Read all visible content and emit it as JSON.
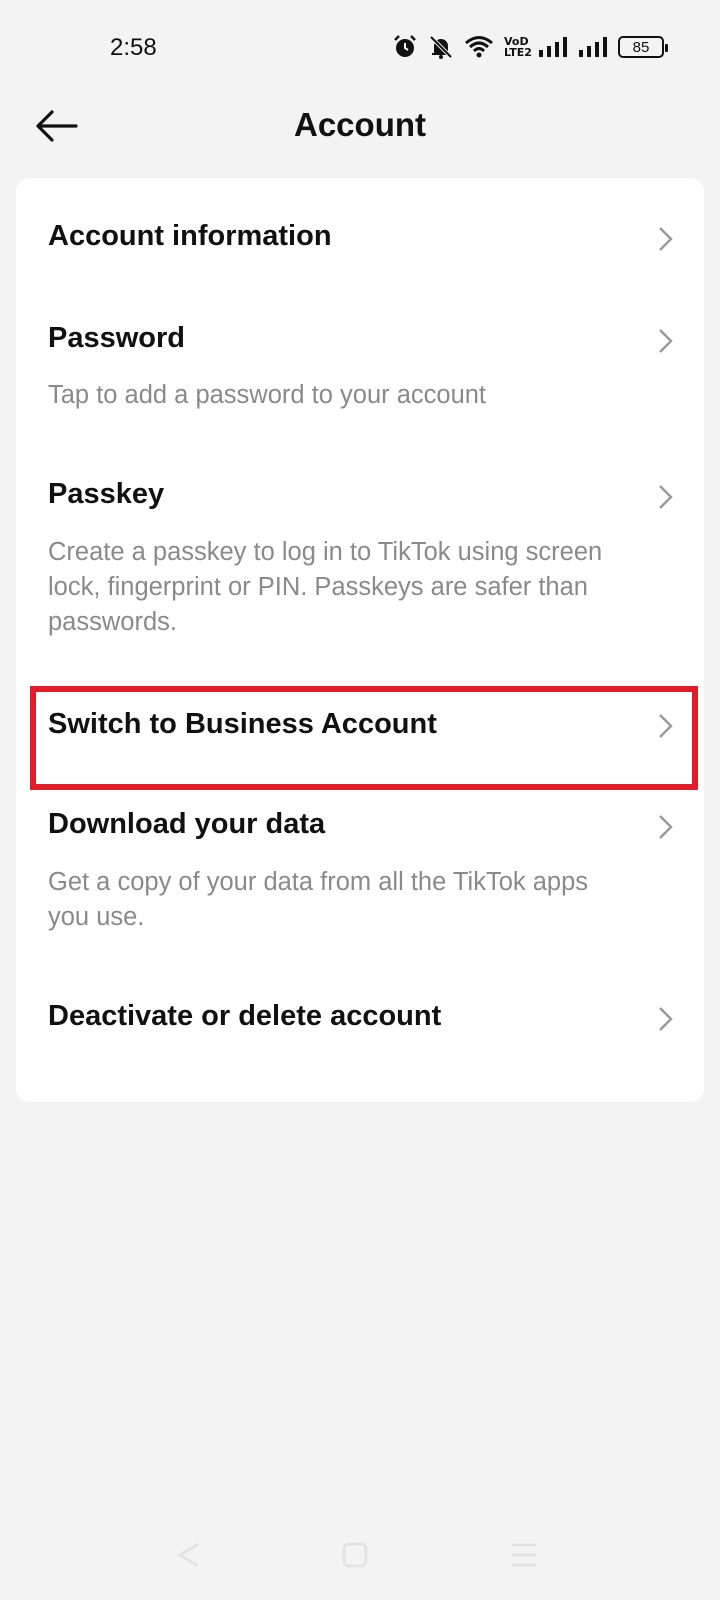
{
  "status_bar": {
    "time": "2:58",
    "network_label": "VoD LTE2",
    "battery": "85"
  },
  "header": {
    "title": "Account"
  },
  "items": [
    {
      "title": "Account information",
      "description": ""
    },
    {
      "title": "Password",
      "description": "Tap to add a password to your account"
    },
    {
      "title": "Passkey",
      "description": "Create a passkey to log in to TikTok using screen lock, fingerprint or PIN. Passkeys are safer than passwords."
    },
    {
      "title": "Switch to Business Account",
      "description": "",
      "highlighted": true
    },
    {
      "title": "Download your data",
      "description": "Get a copy of your data from all the TikTok apps you use."
    },
    {
      "title": "Deactivate or delete account",
      "description": ""
    }
  ],
  "colors": {
    "background": "#f3f3f3",
    "card": "#ffffff",
    "highlight_border": "#e31c2a",
    "secondary_text": "#8a8a8a"
  },
  "icons": {
    "back": "arrow-left-icon",
    "chevron": "chevron-right-icon",
    "alarm": "alarm-icon",
    "mute": "bell-off-icon",
    "wifi": "wifi-icon",
    "signal": "signal-icon"
  }
}
